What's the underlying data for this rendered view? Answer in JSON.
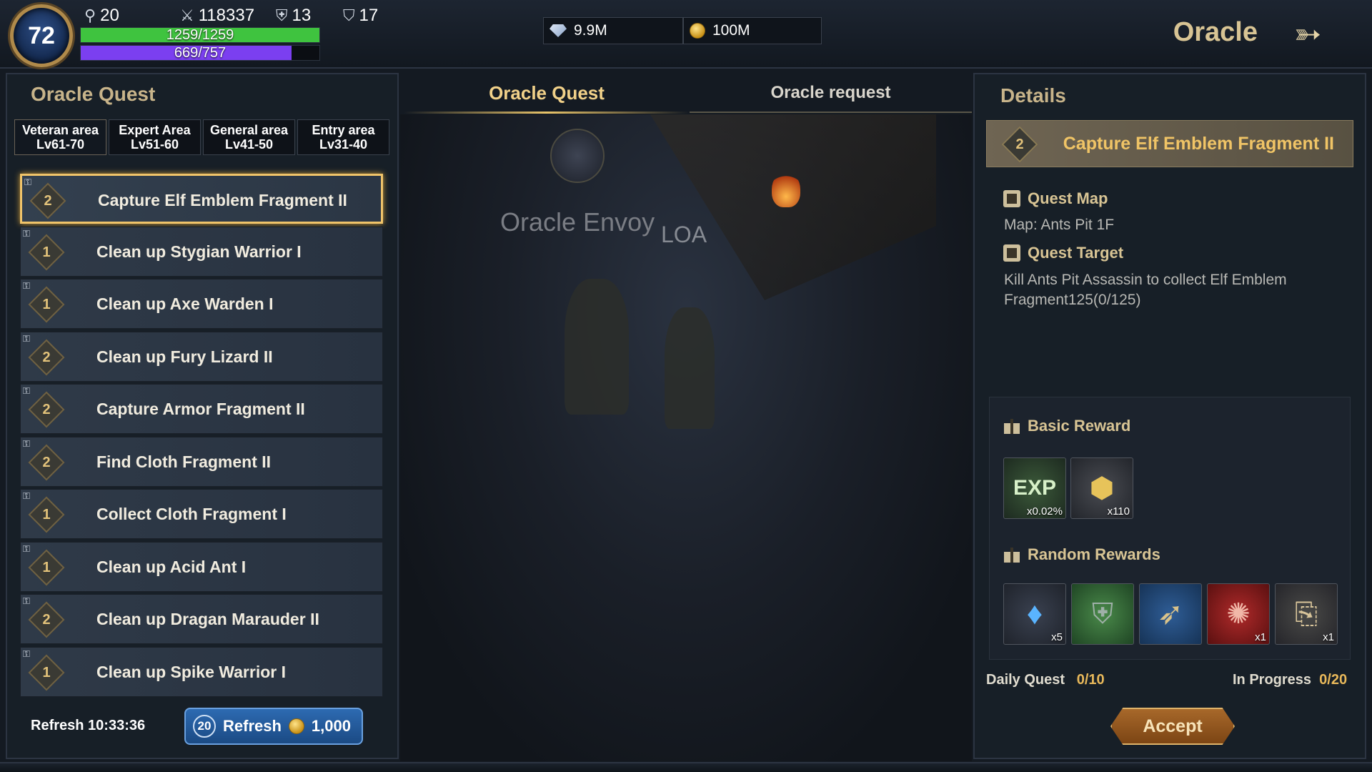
{
  "player": {
    "level": "72",
    "stats": [
      {
        "icon": "rune-icon",
        "value": "20"
      },
      {
        "icon": "swords-icon",
        "value": "118337"
      },
      {
        "icon": "shield-icon",
        "value": "13"
      },
      {
        "icon": "shield-plus-icon",
        "value": "17"
      }
    ],
    "hp": {
      "text": "1259/1259",
      "fraction": 1.0,
      "color": "#3fc33f"
    },
    "mp": {
      "text": "669/757",
      "fraction": 0.884,
      "color": "#7b3ff0"
    }
  },
  "currency": {
    "gems": {
      "icon": "diamond-icon",
      "value": "9.9M"
    },
    "gold": {
      "icon": "gold-coin-icon",
      "value": "100M"
    }
  },
  "header": {
    "title": "Oracle",
    "exit_icon": "arrow-right-icon"
  },
  "left_panel": {
    "title": "Oracle Quest",
    "area_tabs": [
      {
        "name": "Veteran area",
        "range": "Lv61-70"
      },
      {
        "name": "Expert Area",
        "range": "Lv51-60"
      },
      {
        "name": "General area",
        "range": "Lv41-50"
      },
      {
        "name": "Entry area",
        "range": "Lv31-40"
      }
    ],
    "quests": [
      {
        "grade": "2",
        "name": "Capture Elf Emblem Fragment II",
        "selected": true
      },
      {
        "grade": "1",
        "name": "Clean up Stygian Warrior I"
      },
      {
        "grade": "1",
        "name": "Clean up Axe Warden I"
      },
      {
        "grade": "2",
        "name": "Clean up Fury Lizard  II"
      },
      {
        "grade": "2",
        "name": "Capture Armor Fragment II"
      },
      {
        "grade": "2",
        "name": "Find Cloth Fragment II"
      },
      {
        "grade": "1",
        "name": "Collect Cloth Fragment I"
      },
      {
        "grade": "1",
        "name": "Clean up Acid Ant I"
      },
      {
        "grade": "2",
        "name": "Clean up Dragan Marauder II"
      },
      {
        "grade": "1",
        "name": "Clean up Spike Warrior I"
      }
    ],
    "refresh_label": "Refresh",
    "refresh_timer": "10:33:36",
    "refresh_button": {
      "count": "20",
      "label": "Refresh",
      "cost": "1,000"
    }
  },
  "center": {
    "tabs": [
      {
        "label": "Oracle Quest",
        "active": true
      },
      {
        "label": "Oracle request",
        "active": false
      }
    ],
    "npc_name": "Oracle Envoy",
    "npc_guild": "LOA"
  },
  "details": {
    "title": "Details",
    "quest_grade": "2",
    "quest_name": "Capture Elf Emblem Fragment II",
    "quest_map_label": "Quest Map",
    "quest_map_value": "Map: Ants Pit 1F",
    "quest_target_label": "Quest Target",
    "quest_target_line1": "Kill Ants Pit Assassin to collect Elf Emblem",
    "quest_target_line2": "Fragment125(0/125)",
    "basic_reward_label": "Basic Reward",
    "basic_rewards": [
      {
        "icon": "exp-icon",
        "label": "EXP",
        "qty": "x0.02%"
      },
      {
        "icon": "gold-medal-icon",
        "qty": "x110"
      }
    ],
    "random_rewards_label": "Random Rewards",
    "random_rewards": [
      {
        "icon": "blue-crystal-icon",
        "qty": "x5"
      },
      {
        "icon": "green-armor-icon",
        "qty": ""
      },
      {
        "icon": "bow-icon",
        "qty": ""
      },
      {
        "icon": "red-scroll-icon",
        "qty": "x1"
      },
      {
        "icon": "parchment-icon",
        "qty": "x1"
      }
    ],
    "daily_quest_label": "Daily Quest",
    "daily_quest_value": "0/10",
    "in_progress_label": "In Progress",
    "in_progress_value": "0/20",
    "accept_label": "Accept"
  }
}
